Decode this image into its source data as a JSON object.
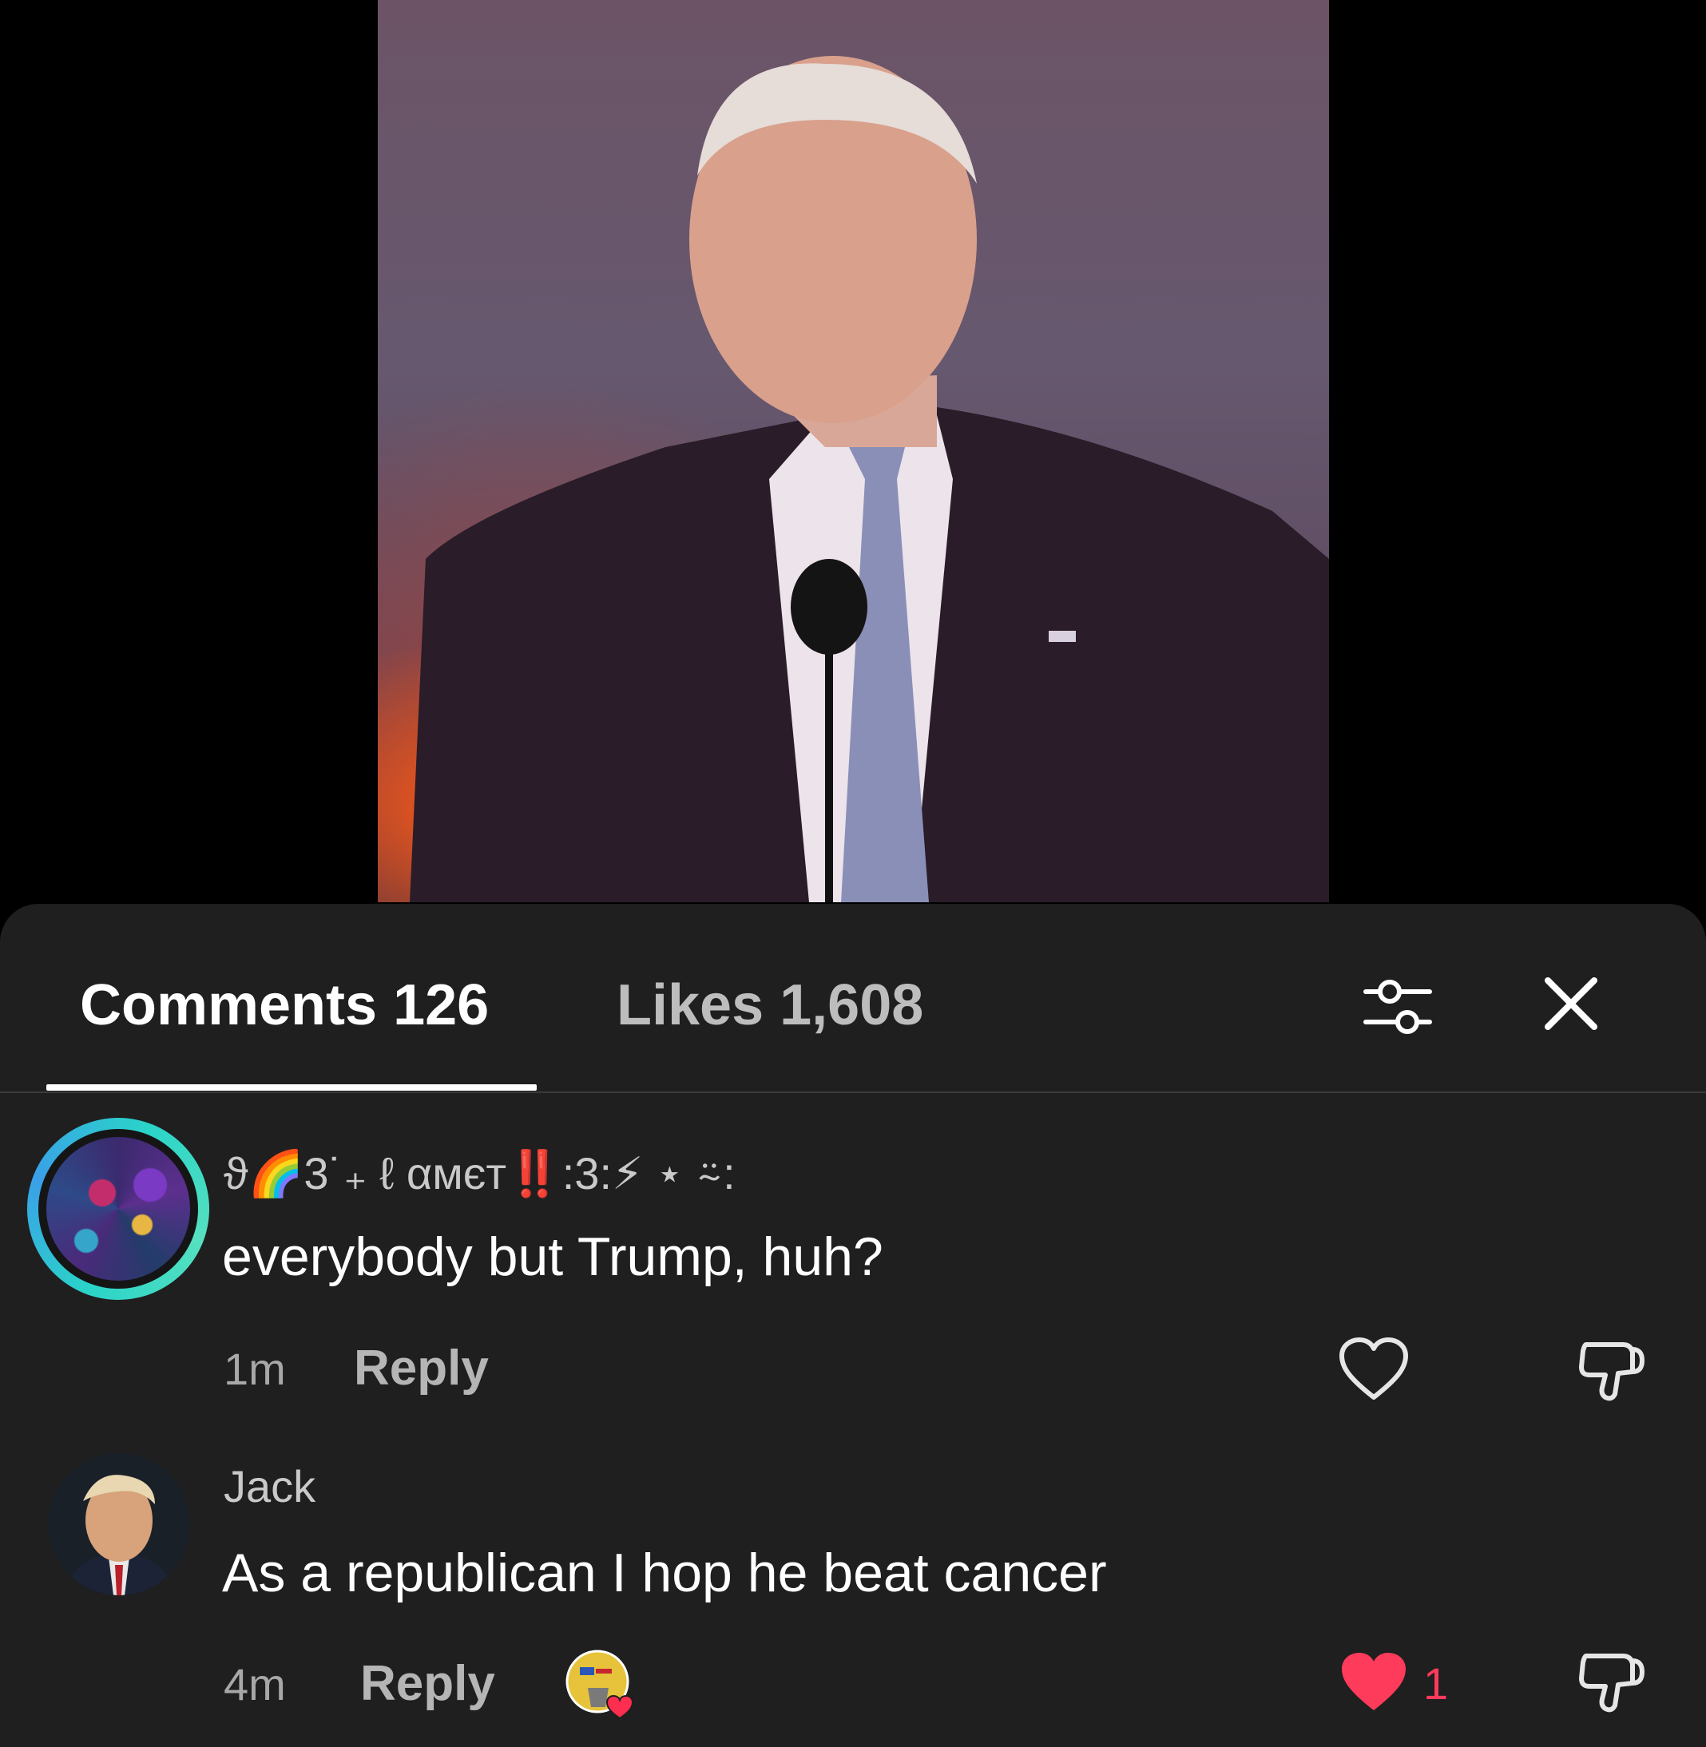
{
  "tabs": {
    "comments_label": "Comments 126",
    "likes_label": "Likes 1,608",
    "active": "comments"
  },
  "comments": [
    {
      "username": "ϑ🌈3˙₊ ℓ αмєт‼️:3:⚡ ⋆ ⍨:",
      "text": "everybody but Trump, huh?",
      "time": "1m",
      "reply_label": "Reply",
      "liked": false,
      "like_count": ""
    },
    {
      "username": "Jack",
      "text": "As a republican I hop he beat cancer",
      "time": "4m",
      "reply_label": "Reply",
      "liked": true,
      "like_count": "1",
      "creator_liked_badge": true
    }
  ],
  "icons": {
    "filter": "sliders-icon",
    "close": "close-icon",
    "like": "heart-icon",
    "dislike": "thumbs-down-icon"
  },
  "colors": {
    "sheet_bg": "#1f1f1f",
    "like_active": "#ff3b5c",
    "avatar_ring": "#2ad4c8"
  }
}
